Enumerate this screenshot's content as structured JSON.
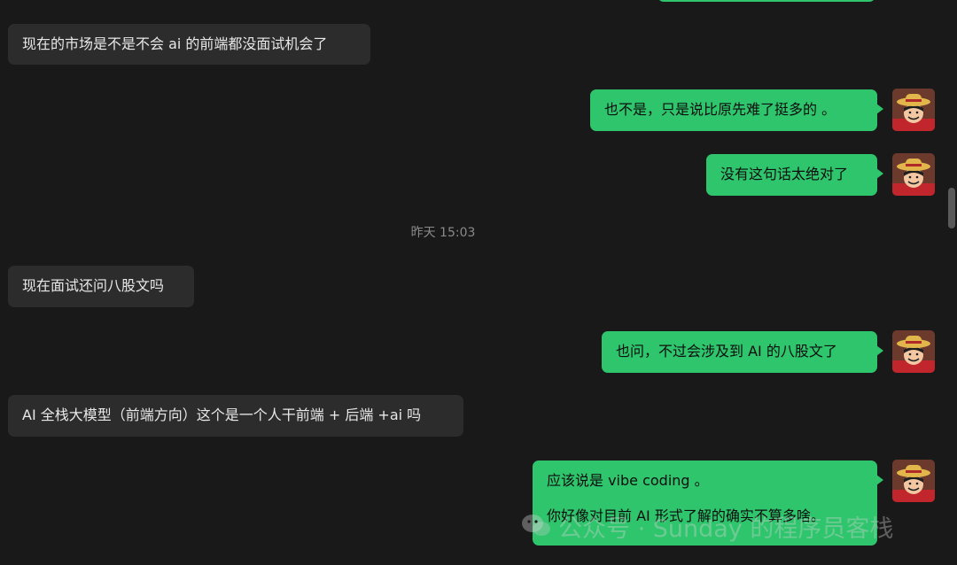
{
  "colors": {
    "background": "#191919",
    "incoming_bubble": "#2c2c2c",
    "outgoing_bubble": "#2ec56c",
    "timestamp": "#8a8a8a"
  },
  "messages": [
    {
      "direction": "in",
      "text": "现在的市场是不是不会 ai 的前端都没面试机会了"
    },
    {
      "direction": "out",
      "text": "也不是，只是说比原先难了挺多的 。"
    },
    {
      "direction": "out",
      "text": "没有这句话太绝对了"
    },
    {
      "direction": "in",
      "text": "现在面试还问八股文吗"
    },
    {
      "direction": "out",
      "text": "也问，不过会涉及到 AI 的八股文了"
    },
    {
      "direction": "in",
      "text": "AI 全栈大模型（前端方向）这个是一个人干前端 + 后端 +ai 吗"
    },
    {
      "direction": "out",
      "lines": [
        "应该说是 vibe coding 。",
        "你好像对目前 AI 形式了解的确实不算多啥。"
      ]
    }
  ],
  "timestamp": "昨天 15:03",
  "avatar": {
    "icon": "straw-hat-avatar-icon"
  },
  "watermark": {
    "icon": "wechat-icon",
    "text": "公众号 · Sunday 的程序员客栈"
  }
}
